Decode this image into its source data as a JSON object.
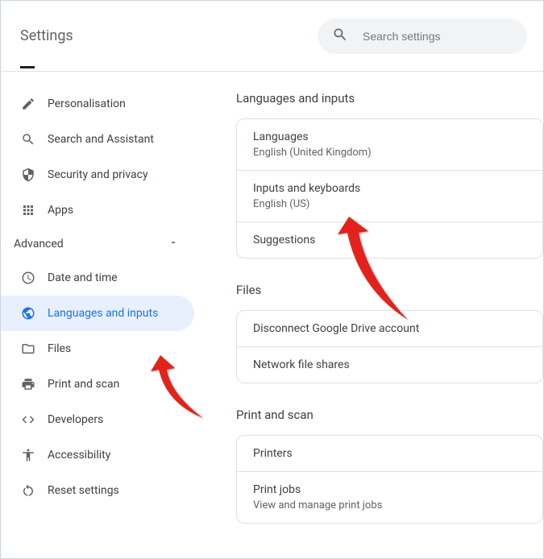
{
  "header": {
    "title": "Settings",
    "search_placeholder": "Search settings"
  },
  "sidebar": {
    "items": [
      {
        "label": "Personalisation"
      },
      {
        "label": "Search and Assistant"
      },
      {
        "label": "Security and privacy"
      },
      {
        "label": "Apps"
      }
    ],
    "advanced_label": "Advanced",
    "advanced_items": [
      {
        "label": "Date and time"
      },
      {
        "label": "Languages and inputs"
      },
      {
        "label": "Files"
      },
      {
        "label": "Print and scan"
      },
      {
        "label": "Developers"
      },
      {
        "label": "Accessibility"
      },
      {
        "label": "Reset settings"
      }
    ]
  },
  "content": {
    "languages_section": {
      "title": "Languages and inputs",
      "items": [
        {
          "primary": "Languages",
          "secondary": "English (United Kingdom)"
        },
        {
          "primary": "Inputs and keyboards",
          "secondary": "English (US)"
        },
        {
          "primary": "Suggestions"
        }
      ]
    },
    "files_section": {
      "title": "Files",
      "items": [
        {
          "primary": "Disconnect Google Drive account"
        },
        {
          "primary": "Network file shares"
        }
      ]
    },
    "print_section": {
      "title": "Print and scan",
      "items": [
        {
          "primary": "Printers"
        },
        {
          "primary": "Print jobs",
          "secondary": "View and manage print jobs"
        }
      ]
    }
  }
}
